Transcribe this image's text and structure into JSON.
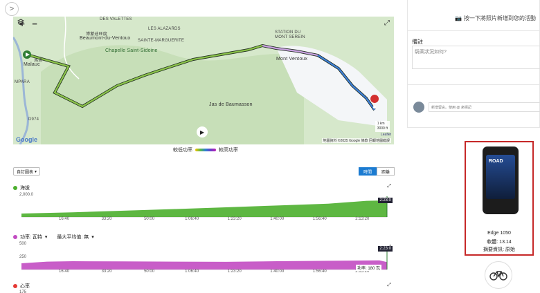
{
  "nav": {
    "expand_icon": ">"
  },
  "map": {
    "zoom_in": "+",
    "zoom_out": "−",
    "labels": [
      {
        "id": "les-valettes",
        "text": "DES VALETTES"
      },
      {
        "id": "beaumont-zh",
        "text": "博蒙迪旺度"
      },
      {
        "id": "beaumont",
        "text": "Beaumont-du-Ventoux"
      },
      {
        "id": "alazards",
        "text": "LES ALAZARDS"
      },
      {
        "id": "sainte-marguerite",
        "text": "SAINTE-MARGUERITE"
      },
      {
        "id": "chapelle",
        "text": "Chapelle Saint-Sidoine"
      },
      {
        "id": "station",
        "text": "STATION DU"
      },
      {
        "id": "mont-serein",
        "text": "MONT SEREIN"
      },
      {
        "id": "mont-ventoux",
        "text": "Mont Ventoux"
      },
      {
        "id": "jas",
        "text": "Jas de Baumasson"
      },
      {
        "id": "malaucene-zh",
        "text": "馬洛"
      },
      {
        "id": "malaucene",
        "text": "Malauc"
      },
      {
        "id": "ampara",
        "text": "MPARA"
      },
      {
        "id": "road",
        "text": "D974"
      }
    ],
    "scale_km": "1 km",
    "scale_ft": "3000 ft",
    "leaflet": "Leaflet",
    "attribution": "地圖資料 ©2025 Google  條款  回報地圖錯誤",
    "google": "Google"
  },
  "legend": {
    "low": "較低功率",
    "high": "較高功率"
  },
  "toolbar": {
    "select_label": "自訂圖表",
    "seg_time": "時間",
    "seg_distance": "距離"
  },
  "elevation": {
    "title": "海拔",
    "color": "#4caf2e",
    "ymax_label": "2,000.0",
    "ticks": [
      "16:40",
      "33:20",
      "50:00",
      "1:06:40",
      "1:23:20",
      "1:40:00",
      "1:56:40",
      "2:13:20"
    ],
    "end_time": "2:23:0"
  },
  "power": {
    "title": "功率: 瓦特",
    "max_avg_label": "最大平均值: 無",
    "color": "#c24bc2",
    "y_labels": [
      "500",
      "250",
      "0"
    ],
    "ticks": [
      "16:40",
      "33:20",
      "50:00",
      "1:06:40",
      "1:23:20",
      "1:40:00",
      "1:56:40",
      "2:13:20"
    ],
    "end_time": "2:23:0",
    "readout": "功率: 180 瓦"
  },
  "heart": {
    "title": "心率",
    "color": "#e53935",
    "y_label": "175"
  },
  "right": {
    "photo_hint": "按一下將照片新增到您的活動",
    "notes_title": "備註",
    "notes_placeholder": "騎乘狀況如何?",
    "comment_placeholder": "新增留言。使用 @ 來標記"
  },
  "device": {
    "name": "Edge 1050",
    "firmware": "軟體: 13.14",
    "summary": "摘要資訊: 原始",
    "screen_text": "ROAD"
  },
  "chart_data": [
    {
      "type": "area",
      "title": "海拔",
      "x_label": "",
      "x_ticks": [
        "16:40",
        "33:20",
        "50:00",
        "1:06:40",
        "1:23:20",
        "1:40:00",
        "1:56:40",
        "2:13:20"
      ],
      "series": [
        {
          "name": "海拔",
          "x_minutes": [
            0,
            20,
            40,
            60,
            80,
            100,
            120,
            135,
            143
          ],
          "values": [
            380,
            520,
            700,
            880,
            1080,
            1280,
            1480,
            1800,
            1850
          ]
        }
      ],
      "ylim": [
        0,
        2000
      ]
    },
    {
      "type": "area",
      "title": "功率: 瓦特",
      "x_ticks": [
        "16:40",
        "33:20",
        "50:00",
        "1:06:40",
        "1:23:20",
        "1:40:00",
        "1:56:40",
        "2:13:20"
      ],
      "series": [
        {
          "name": "功率",
          "x_minutes": [
            0,
            10,
            20,
            40,
            60,
            80,
            100,
            120,
            140,
            143
          ],
          "values": [
            150,
            190,
            200,
            195,
            190,
            185,
            200,
            210,
            220,
            180
          ]
        }
      ],
      "ylim": [
        0,
        500
      ]
    }
  ]
}
